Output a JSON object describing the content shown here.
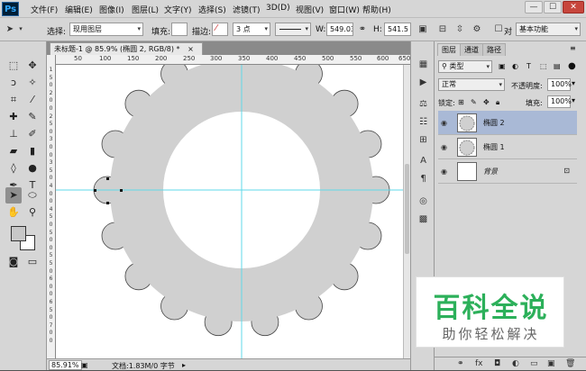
{
  "app": {
    "logo": "Ps"
  },
  "menu": [
    "文件(F)",
    "编辑(E)",
    "图像(I)",
    "图层(L)",
    "文字(Y)",
    "选择(S)",
    "滤镜(T)",
    "3D(D)",
    "视图(V)",
    "窗口(W)",
    "帮助(H)"
  ],
  "window_buttons": [
    "—",
    "☐",
    "✕"
  ],
  "options": {
    "select_label": "选择:",
    "select_value": "现用图层",
    "fill_label": "填充:",
    "stroke_label": "描边:",
    "stroke_width": "3 点",
    "w_label": "W:",
    "w_value": "549.03",
    "h_label": "H:",
    "h_value": "541.5 f",
    "align_label": "对",
    "workspace": "基本功能"
  },
  "document": {
    "tab_title": "未标题-1 @ 85.9% (椭圆 2, RGB/8) *",
    "tab_close": "×",
    "ruler_h": [
      "50",
      "100",
      "150",
      "200",
      "250",
      "300",
      "350",
      "400",
      "450",
      "500",
      "550",
      "600",
      "650"
    ],
    "ruler_v": [
      "1",
      "5",
      "0",
      "2",
      "0",
      "0",
      "2",
      "5",
      "0",
      "3",
      "0",
      "0",
      "3",
      "5",
      "0",
      "4",
      "0",
      "0",
      "4",
      "5",
      "0",
      "5",
      "0",
      "0",
      "5",
      "5",
      "0",
      "6",
      "0",
      "0",
      "6",
      "5",
      "0",
      "7",
      "0",
      "0"
    ],
    "canvas_bg": "#ffffff",
    "shape_fill": "#d0d0d0",
    "guide_color": "#5fd8e8"
  },
  "status": {
    "zoom": "85.91%",
    "doc": "文档:1.83M/0 字节"
  },
  "panel": {
    "tabs": [
      "图层",
      "通道",
      "路径"
    ],
    "kind_label": "类型",
    "blend_mode": "正常",
    "opacity_label": "不透明度:",
    "opacity_value": "100%",
    "lock_label": "锁定:",
    "fill_label": "填充:",
    "fill_value": "100%",
    "layers": [
      {
        "name": "椭圆 2",
        "selected": true
      },
      {
        "name": "椭圆 1",
        "selected": false
      },
      {
        "name": "背景",
        "selected": false
      }
    ]
  },
  "watermark": {
    "title": "百科全说",
    "subtitle": "助你轻松解决"
  }
}
